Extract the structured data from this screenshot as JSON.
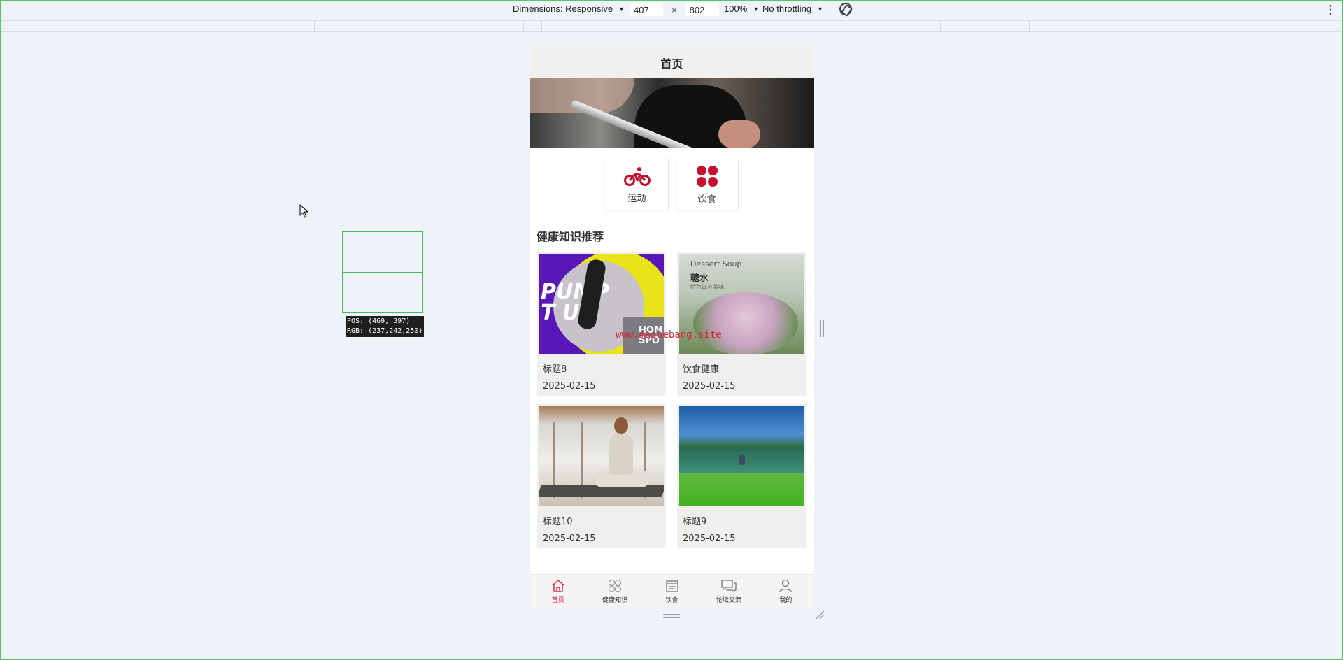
{
  "devtools": {
    "dimensions_label": "Dimensions: Responsive",
    "width": "407",
    "times": "×",
    "height": "802",
    "zoom": "100%",
    "throttling": "No throttling"
  },
  "picker": {
    "pos": "POS:  (469, 397)",
    "rgb": "RGB:  (237,242,250)"
  },
  "app": {
    "header_title": "首页",
    "categories": [
      {
        "label": "运动",
        "icon": "bicycle-icon"
      },
      {
        "label": "饮食",
        "icon": "four-dots-icon"
      }
    ],
    "section_title": "健康知识推荐",
    "cards": [
      {
        "title": "标题8",
        "date": "2025-02-15",
        "image_text_1": "PUMP",
        "image_text_2": "T UP",
        "image_text_3": "HOME",
        "image_text_4": "SPO"
      },
      {
        "title": "饮食健康",
        "date": "2025-02-15",
        "image_text_1": "Dessert Soup",
        "image_text_2": "糖水",
        "image_text_3": "特色滋补美味"
      },
      {
        "title": "标题10",
        "date": "2025-02-15"
      },
      {
        "title": "标题9",
        "date": "2025-02-15"
      }
    ],
    "watermark": "www.mashebang.site",
    "tabs": [
      {
        "label": "首页",
        "icon": "home-icon",
        "active": true
      },
      {
        "label": "健康知识",
        "icon": "grid-icon",
        "active": false
      },
      {
        "label": "饮食",
        "icon": "calendar-icon",
        "active": false
      },
      {
        "label": "论坛交流",
        "icon": "chat-icon",
        "active": false
      },
      {
        "label": "我的",
        "icon": "user-icon",
        "active": false
      }
    ],
    "accent": "#e0203a"
  }
}
